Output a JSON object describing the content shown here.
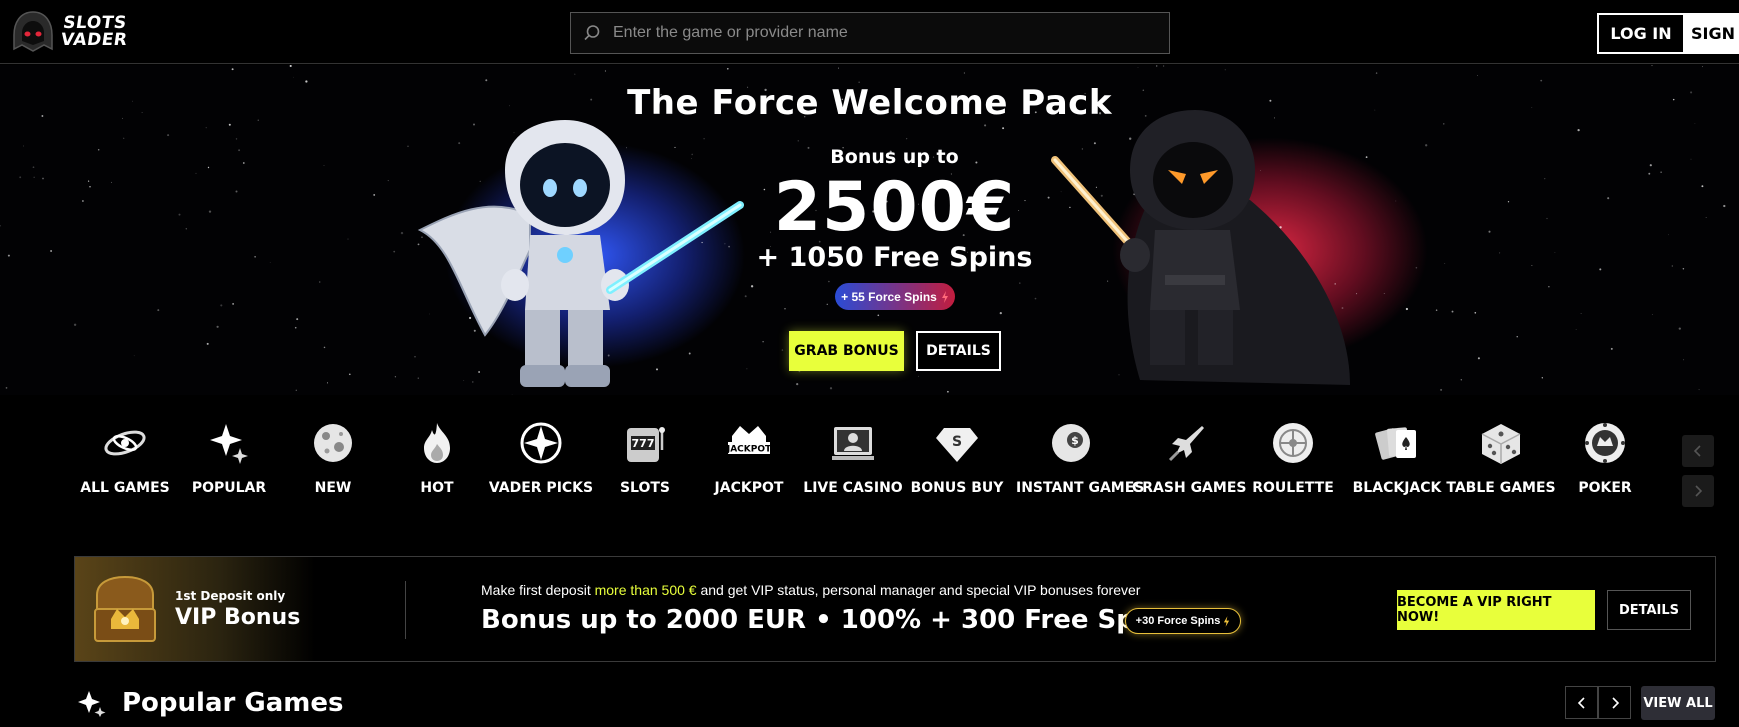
{
  "header": {
    "logo_line1": "SLOTS",
    "logo_line2": "VADER",
    "search_placeholder": "Enter the game or provider name",
    "login_label": "LOG IN",
    "signup_label": "SIGN"
  },
  "hero": {
    "title": "The Force Welcome Pack",
    "bonus_prefix": "Bonus up to",
    "amount": "2500€",
    "spins": "+ 1050 Free Spins",
    "force_badge": "+ 55 Force Spins",
    "grab_label": "GRAB BONUS",
    "details_label": "DETAILS",
    "colors": {
      "left_glow": "#3257ff",
      "right_glow": "#e6284a",
      "cta": "#e8ff3b"
    }
  },
  "categories": [
    {
      "label": "ALL GAMES",
      "icon": "galaxy-icon"
    },
    {
      "label": "POPULAR",
      "icon": "sparkle-icon"
    },
    {
      "label": "NEW",
      "icon": "planet-icon"
    },
    {
      "label": "HOT",
      "icon": "flame-icon"
    },
    {
      "label": "VADER PICKS",
      "icon": "compass-icon"
    },
    {
      "label": "SLOTS",
      "icon": "slot-machine-icon"
    },
    {
      "label": "JACKPOT",
      "icon": "jackpot-icon"
    },
    {
      "label": "LIVE CASINO",
      "icon": "live-dealer-icon"
    },
    {
      "label": "BONUS BUY",
      "icon": "diamond-icon"
    },
    {
      "label": "INSTANT GAMES",
      "icon": "coin-icon"
    },
    {
      "label": "CRASH GAMES",
      "icon": "spaceship-icon"
    },
    {
      "label": "ROULETTE",
      "icon": "roulette-icon"
    },
    {
      "label": "BLACKJACK",
      "icon": "cards-icon"
    },
    {
      "label": "TABLE GAMES",
      "icon": "dice-icon"
    },
    {
      "label": "POKER",
      "icon": "poker-chip-icon"
    }
  ],
  "vip": {
    "small": "1st Deposit only",
    "big": "VIP Bonus",
    "desc_before": "Make first deposit ",
    "desc_highlight": "more than 500 €",
    "desc_after": " and get VIP status, personal manager and special VIP bonuses forever",
    "offer": "Bonus up to 2000 EUR • 100% + 300 Free Spins",
    "badge": "+30 Force Spins",
    "cta_label": "BECOME A VIP RIGHT NOW!",
    "details_label": "DETAILS"
  },
  "popular": {
    "title": "Popular Games",
    "view_all_label": "VIEW ALL"
  }
}
